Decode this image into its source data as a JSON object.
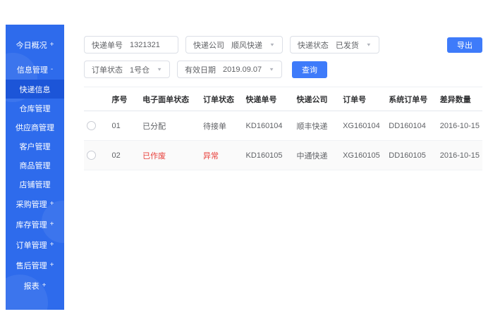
{
  "sidebar": {
    "menu": [
      {
        "label": "今日概况",
        "toggle": "+"
      },
      {
        "label": "信息管理",
        "toggle": "-"
      },
      {
        "label": "快递信息"
      },
      {
        "label": "仓库管理"
      },
      {
        "label": "供应商管理"
      },
      {
        "label": "客户管理"
      },
      {
        "label": "商品管理"
      },
      {
        "label": "店铺管理"
      },
      {
        "label": "采购管理",
        "toggle": "+"
      },
      {
        "label": "库存管理",
        "toggle": "+"
      },
      {
        "label": "订单管理",
        "toggle": "+"
      },
      {
        "label": "售后管理",
        "toggle": "+"
      },
      {
        "label": "报表",
        "toggle": "+"
      }
    ]
  },
  "filters": {
    "row1": [
      {
        "label": "快递单号",
        "value": "1321321",
        "type": "input"
      },
      {
        "label": "快递公司",
        "value": "顺风快递",
        "type": "select"
      },
      {
        "label": "快递状态",
        "value": "已发货",
        "type": "select"
      }
    ],
    "row2": [
      {
        "label": "订单状态",
        "value": "1号仓",
        "type": "select"
      },
      {
        "label": "有效日期",
        "value": "2019.09.07",
        "type": "select"
      }
    ],
    "search_label": "查询",
    "export_label": "导出"
  },
  "table": {
    "headers": [
      "序号",
      "电子面单状态",
      "订单状态",
      "快递单号",
      "快递公司",
      "订单号",
      "系统订单号",
      "差异数量"
    ],
    "rows": [
      {
        "cells": [
          "01",
          "已分配",
          "待接单",
          "KD160104",
          "顺丰快递",
          "XG160104",
          "DD160104",
          "2016-10-15"
        ]
      },
      {
        "cells": [
          "02",
          "已作废",
          "异常",
          "KD160105",
          "中通快递",
          "XG160105",
          "DD160105",
          "2016-10-15"
        ]
      }
    ]
  },
  "colors": {
    "sidebar_blue": "#2e6bec",
    "active_item_blue": "#1c55d8",
    "button_blue": "#3e7bfa",
    "alert_red": "#e8413c"
  }
}
